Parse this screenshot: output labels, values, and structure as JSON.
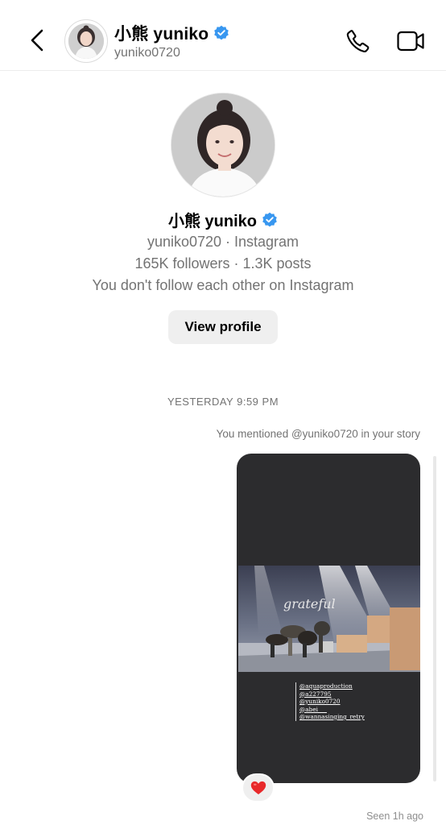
{
  "header": {
    "display_name": "小熊 yuniko",
    "username": "yuniko0720"
  },
  "profile": {
    "display_name": "小熊 yuniko",
    "meta_line": "yuniko0720 · Instagram",
    "stats_line": "165K followers · 1.3K posts",
    "follow_status": "You don't follow each other on Instagram",
    "view_profile_label": "View profile"
  },
  "conversation": {
    "timestamp": "YESTERDAY 9:59 PM",
    "mention_note": "You mentioned @yuniko0720 in your story",
    "story": {
      "overlay_text": "grateful",
      "tags": [
        "@aquaproduction",
        "@a227795",
        "@yuniko0720",
        "@abei___",
        "@wannasinging_retry"
      ]
    },
    "reaction": "❤️",
    "seen_status": "Seen 1h ago"
  },
  "icons": {
    "back": "back-chevron-icon",
    "verified": "verified-badge-icon",
    "call": "phone-icon",
    "video": "video-camera-icon"
  },
  "colors": {
    "verified_blue": "#3897f0",
    "secondary_text": "#737373",
    "button_bg": "#efefef",
    "story_bg": "#2c2c2e",
    "heart_red": "#e8292b"
  }
}
